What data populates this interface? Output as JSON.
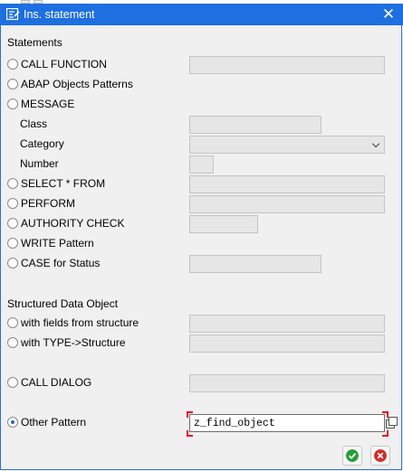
{
  "window": {
    "title": "Ins. statement",
    "colors": {
      "titlebar": "#1e6fe0",
      "ok": "#2a9d3c",
      "cancel": "#d52b2b"
    }
  },
  "sections": {
    "statements": "Statements",
    "structured": "Structured Data Object"
  },
  "options": {
    "call_function": "CALL FUNCTION",
    "abap_objects": "ABAP Objects Patterns",
    "message": "MESSAGE",
    "select_from": "SELECT * FROM",
    "perform": "PERFORM",
    "authority_check": "AUTHORITY CHECK",
    "write_pattern": "WRITE Pattern",
    "case_status": "CASE for Status",
    "fields_structure": "with fields from structure",
    "type_structure": "with TYPE->Structure",
    "call_dialog": "CALL DIALOG",
    "other_pattern": "Other Pattern"
  },
  "message_fields": {
    "class": "Class",
    "category": "Category",
    "number": "Number"
  },
  "other_pattern_value": "z_find_object",
  "selected_option": "other_pattern",
  "icons": {
    "title": "insert-statement-icon",
    "close": "close-icon",
    "value_help": "value-help-icon",
    "ok": "checkmark-icon",
    "cancel": "cancel-x-icon"
  }
}
